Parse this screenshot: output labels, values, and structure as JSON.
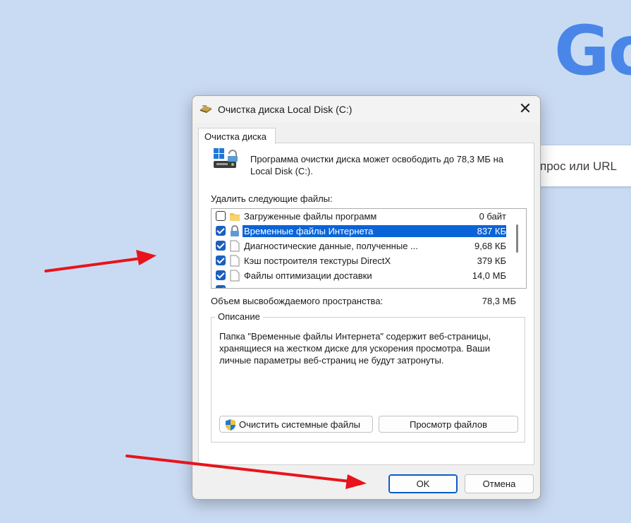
{
  "background": {
    "logo_text": "Go",
    "search_placeholder_partial": "прос или URL"
  },
  "dialog": {
    "title": "Очистка диска Local Disk (C:)",
    "close_glyph": "✕",
    "tab_label": "Очистка диска",
    "intro_text": "Программа очистки диска может освободить до 78,3 МБ на Local Disk (C:).",
    "files_label": "Удалить следующие файлы:",
    "files": [
      {
        "name": "Загруженные файлы программ",
        "size": "0 байт",
        "checked": false,
        "icon": "folder-icon"
      },
      {
        "name": "Временные файлы Интернета",
        "size": "837 КБ",
        "checked": true,
        "selected": true,
        "icon": "lock-icon"
      },
      {
        "name": "Диагностические данные, полученные ...",
        "size": "9,68 КБ",
        "checked": true,
        "icon": "file-icon"
      },
      {
        "name": "Кэш построителя текстуры DirectX",
        "size": "379 КБ",
        "checked": true,
        "icon": "file-icon"
      },
      {
        "name": "Файлы оптимизации доставки",
        "size": "14,0 МБ",
        "checked": true,
        "icon": "file-icon"
      }
    ],
    "total_label": "Объем высвобождаемого пространства:",
    "total_value": "78,3 МБ",
    "description_title": "Описание",
    "description_text": "Папка \"Временные файлы Интернета\" содержит веб-страницы, хранящиеся на жестком диске для ускорения просмотра. Ваши личные параметры веб-страниц не будут затронуты.",
    "clean_system_label": "Очистить системные файлы",
    "view_files_label": "Просмотр файлов",
    "ok_label": "OK",
    "cancel_label": "Отмена"
  },
  "colors": {
    "accent": "#0a64d8",
    "annotation_arrow": "#e8141b"
  }
}
